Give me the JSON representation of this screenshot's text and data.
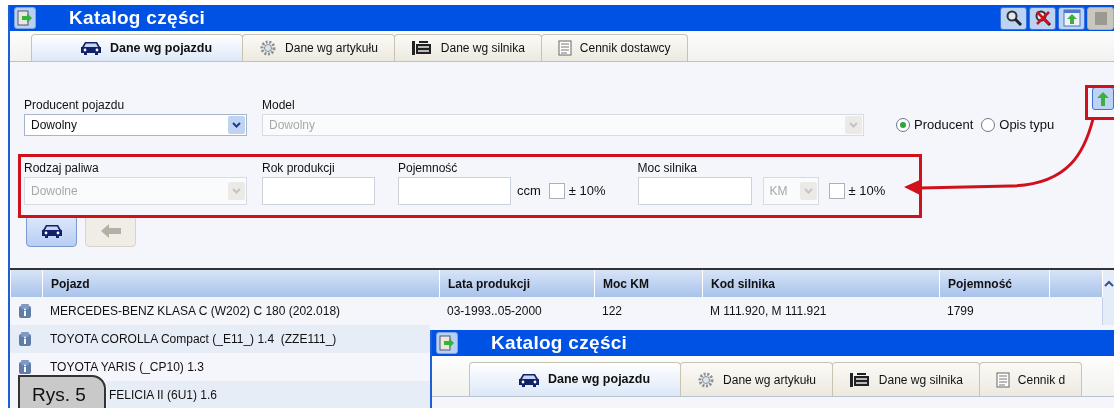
{
  "window": {
    "title": "Katalog części"
  },
  "tabs": [
    {
      "label": "Dane wg pojazdu",
      "selected": true
    },
    {
      "label": "Dane wg artykułu",
      "selected": false
    },
    {
      "label": "Dane wg silnika",
      "selected": false
    },
    {
      "label": "Cennik dostawcy",
      "selected": false
    }
  ],
  "filters": {
    "producer": {
      "label": "Producent pojazdu",
      "value": "Dowolny",
      "disabled": false
    },
    "model": {
      "label": "Model",
      "value": "Dowolny",
      "disabled": true
    },
    "search_by": [
      {
        "label": "Producent",
        "selected": true
      },
      {
        "label": "Opis typu",
        "selected": false
      }
    ],
    "fuel": {
      "label": "Rodzaj paliwa",
      "value": "Dowolne",
      "disabled": true
    },
    "year": {
      "label": "Rok produkcji"
    },
    "capacity": {
      "label": "Pojemność",
      "unit": "ccm",
      "tolerance": {
        "label": "± 10%",
        "checked": false
      }
    },
    "power": {
      "label": "Moc silnika",
      "unit": "KM",
      "unit_disabled": true,
      "tolerance": {
        "label": "± 10%",
        "checked": false
      }
    }
  },
  "action_buttons": [
    {
      "disabled": false
    },
    {
      "disabled": true
    }
  ],
  "table": {
    "columns": [
      "Pojazd",
      "Lata produkcji",
      "Moc KM",
      "Kod silnika",
      "Pojemność"
    ],
    "rows": [
      [
        "MERCEDES-BENZ KLASA C (W202) C 180 (202.018)",
        "03-1993..05-2000",
        "122",
        "M 111.920, M 111.921",
        "1799"
      ],
      [
        "TOYOTA COROLLA Compact (_E11_) 1.4  (ZZE111_)"
      ],
      [
        "TOYOTA YARIS (_CP10) 1.3"
      ],
      [
        "FELICIA II (6U1) 1.6"
      ]
    ]
  },
  "second_window": {
    "title": "Katalog części",
    "tabs": [
      {
        "label": "Dane wg pojazdu",
        "selected": true
      },
      {
        "label": "Dane wg artykułu",
        "selected": false
      },
      {
        "label": "Dane wg silnika",
        "selected": false
      },
      {
        "label": "Cennik d",
        "selected": false
      }
    ]
  },
  "figure_label": "Rys. 5"
}
